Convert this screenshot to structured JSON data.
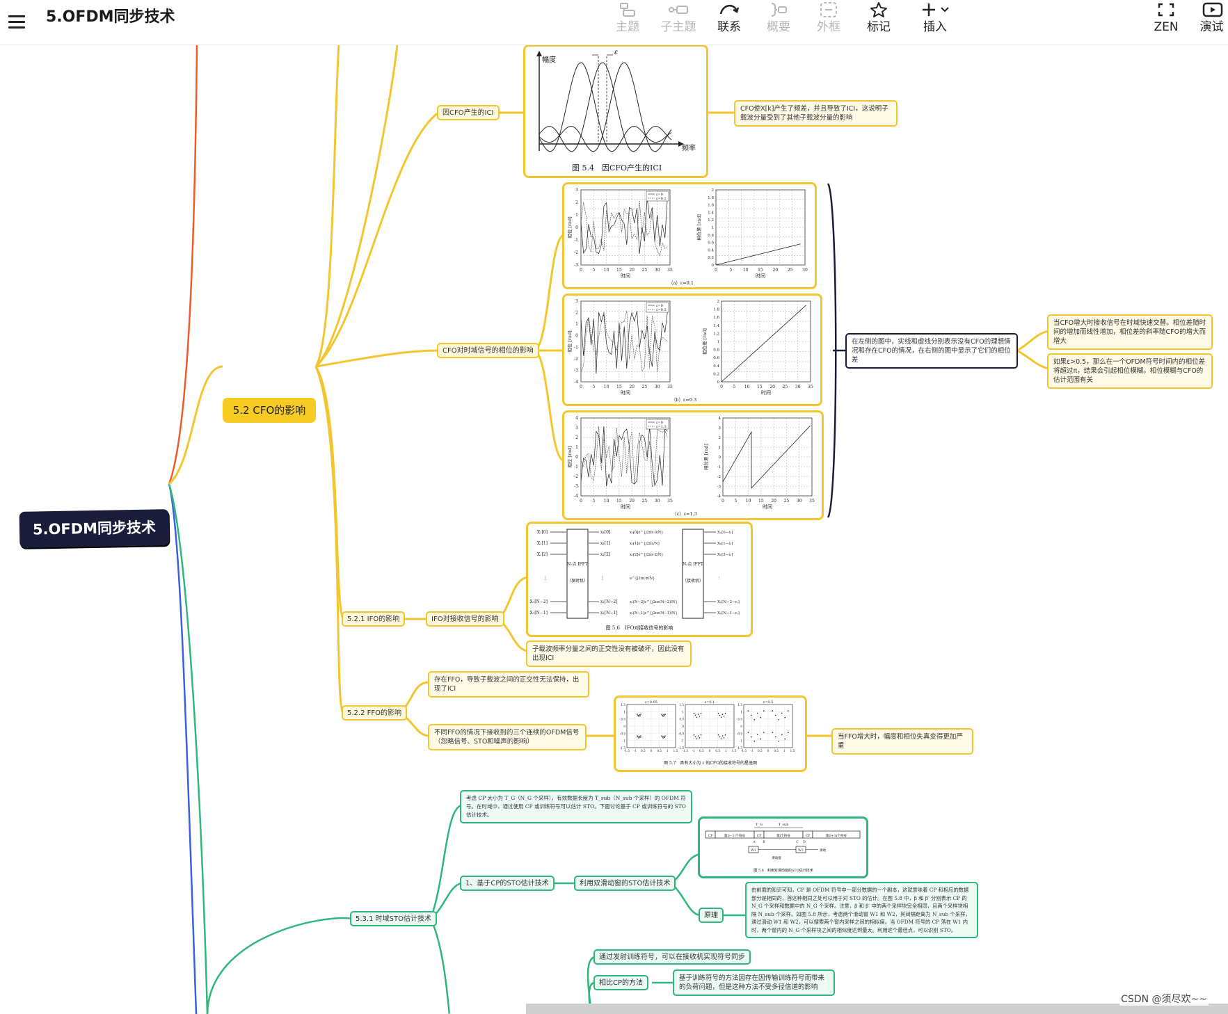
{
  "title": "5.OFDM同步技术",
  "toolbar": {
    "topic": "主题",
    "subtopic": "子主题",
    "relation": "联系",
    "summary": "概要",
    "boundary": "外框",
    "marker": "标记",
    "insert": "插入",
    "zen": "ZEN",
    "present": "演试"
  },
  "mindmap": {
    "root": "5.OFDM同步技术",
    "cfo": {
      "label": "5.2 CFO的影响",
      "ici": {
        "label": "因CFO产生的ICI",
        "note": "CFO使X[k]产生了频差，并且导致了ICI，这说明子载波分量受到了其他子载波分量的影响",
        "fig": {
          "ylabel": "幅度",
          "xlabel": "频率",
          "eps": "ε",
          "caption": "图 5.4　因CFO产生的ICI"
        }
      },
      "phase": {
        "label": "CFO对时域信号的相位的影响",
        "desc": "在左侧的图中，实线和虚线分别表示没有CFO的理想情况和存在CFO的情况，在右侧的图中显示了它们的相位差",
        "notes": [
          "当CFO增大时接收信号在时域快速交替。相位差随时间的增加而线性增加，相位差的斜率随CFO的增大而增大",
          "如果ε>0.5，那么在一个OFDM符号时间内的相位差将超过π，结果会引起相位模糊。相位模糊与CFO的估计范围有关"
        ],
        "panels": [
          {
            "left_ylabel": "相位 [rad]",
            "right_ylabel": "相位差 [rad]",
            "xlabel": "时间",
            "left_yticks": [
              "3",
              "2",
              "1",
              "0",
              "-1",
              "-2",
              "-3"
            ],
            "right_yticks": [
              "2",
              "1.8",
              "1.6",
              "1.4",
              "1.2",
              "1",
              "0.8",
              "0.6",
              "0.4",
              "0.2",
              "0"
            ],
            "xticks": [
              "0",
              "5",
              "10",
              "15",
              "20",
              "25",
              "30",
              "35"
            ],
            "right_xticks": [
              "0",
              "5",
              "10",
              "15",
              "20",
              "25",
              "30"
            ],
            "legend": [
              "ε=0",
              "ε=0.1"
            ],
            "caption": "（a）ε=0.1"
          },
          {
            "left_ylabel": "相位 [rad]",
            "right_ylabel": "相位差 [rad]",
            "xlabel": "时间",
            "left_yticks": [
              "3",
              "2",
              "1",
              "0",
              "-1",
              "-2",
              "-3",
              "-4"
            ],
            "right_yticks": [
              "2",
              "1.8",
              "1.6",
              "1.4",
              "1.2",
              "1",
              "0.8",
              "0.6",
              "0.4",
              "0.2",
              "0"
            ],
            "xticks": [
              "0",
              "5",
              "10",
              "15",
              "20",
              "25",
              "30",
              "35"
            ],
            "right_xticks": [
              "0",
              "5",
              "10",
              "15",
              "20",
              "25",
              "30",
              "35"
            ],
            "legend": [
              "ε=0",
              "ε=0.5"
            ],
            "caption": "（b）ε=0.3"
          },
          {
            "left_ylabel": "相位 [rad]",
            "right_ylabel": "相位差 [rad]",
            "xlabel": "时间",
            "left_yticks": [
              "4",
              "3",
              "2",
              "1",
              "0",
              "-1",
              "-2",
              "-3",
              "-4"
            ],
            "right_yticks": [
              "4",
              "3",
              "2",
              "1",
              "0",
              "-1",
              "-2",
              "-3",
              "-4"
            ],
            "xticks": [
              "0",
              "5",
              "10",
              "15",
              "20",
              "25",
              "30",
              "35"
            ],
            "right_xticks": [
              "0",
              "5",
              "10",
              "15",
              "20",
              "25",
              "30",
              "35"
            ],
            "legend": [
              "ε=0",
              "ε=1.3"
            ],
            "caption": "（c）ε=1.3"
          }
        ]
      },
      "ifo": {
        "label": "5.2.1 IFO的影响",
        "child": "IFO对接收信号的影响",
        "note": "子载波频率分量之间的正交性没有被破坏，因此没有出现ICI",
        "fig": {
          "tx_block": "N-点 IFFT",
          "tx_label": "（发射机）",
          "rx_block": "N-点 IFFT",
          "rx_label": "（接收机）",
          "inputs": [
            "X₁[0]",
            "X₁[1]",
            "X₁[2]",
            "⋮",
            "X₁[N−2]",
            "X₁[N−1]"
          ],
          "tx_out": [
            "x₁[0]",
            "x₁[1]",
            "x₁[2]",
            "⋮",
            "x₁[N−2]",
            "x₁[N−1]"
          ],
          "channel": [
            "x₁[0]e^{j2πε·0/N}",
            "x₁[1]e^{j2πε/N}",
            "x₁[2]e^{j2πε·2/N}",
            "e^{j2πε·n/N}",
            "x₁[N−2]e^{j2πε(N−2)/N}",
            "x₁[N−1]e^{j2πε(N−1)/N}"
          ],
          "outputs": [
            "X₁[0−εᵢ]",
            "X₁[1−εᵢ]",
            "X₁[2−εᵢ]",
            "⋮",
            "X₁[N−2−εᵢ]",
            "X₁[N−1−εᵢ]"
          ],
          "caption": "图 5.6　IFO对接收信号的影响"
        }
      },
      "ffo": {
        "label": "5.2.2 FFO的影响",
        "child1": "存在FFO，导致子载波之间的正交性无法保持，出现了ICI",
        "child2": "不同FFO的情况下接收到的三个连续的OFDM信号（忽略信号、STO和噪声的影响）",
        "note": "当FFO增大时，幅度和相位失真变得更加严重",
        "fig": {
          "titles": [
            "ε=0.05",
            "ε=0.1",
            "ε=0.5"
          ],
          "yticks": [
            "1.5",
            "1",
            "0.5",
            "0",
            "-0.5",
            "-1",
            "-1.5"
          ],
          "xticks": [
            "-1.5",
            "-1",
            "0.5",
            "0",
            "0.5",
            "1",
            "1.5"
          ],
          "caption": "图 5.7　具有大小为 ε 的CFO的接收符号的星座图"
        }
      }
    },
    "sto": {
      "label": "5.3.1 时域STO估计技术",
      "intro": "考虑 CP 大小为 T_G（N_G 个采样），有效数据长度为 T_sub（N_sub 个采样）的 OFDM 符号。在时域中，通过使用 CP 或训练符号可以估计 STO。下面讨论基于 CP 或训练符号的 STO 估计技术。",
      "cp_based": "1、基于CP的STO估计技术",
      "sliding": "利用双滑动窗的STO估计技术",
      "principle": "原理",
      "principle_text": "由前面的知识可知，CP 是 OFDM 符号中一部分数据的一个副本，这就意味着 CP 和相应的数据部分是相同的，首这种相同之处可以用于对 STO 的估计。在图 5.8 中，β 和 β′ 分别表示 CP 的 N_G 个采样和数据中的 N_G 个采样。注意，β 和 β′ 中的两个采样块完全相同，且两个采样块相隔 N_sub 个采样。如图 5.8 所示，考虑两个滑动窗 W1 和 W2，其间隔距离为 N_sub 个采样，通过滑动 W1 和 W2，可以搜索两个窗内采样之间的相似度。当 OFDM 符号的 CP 落在 W1 内时，两个窗内的 N_G 个采样块之间的相似度达到最大。利用这个最佳点，可以识别 STO。",
      "fig": {
        "segments": [
          "CP",
          "第(l−1)个符号",
          "CP",
          "第l个符号",
          "CP",
          "第(l+1)个符号"
        ],
        "marks": [
          "A",
          "B",
          "C",
          "D"
        ],
        "w1": "W1",
        "w2": "W2",
        "tg": "T_G",
        "tsub": "T_sub",
        "slide": "滑动窗",
        "move": "滑动",
        "caption": "图 5.8　利用双滑动窗的STO估计技术"
      },
      "training": "通过发射训练符号，可以在接收机实现符号同步",
      "compare": "相比CP的方法",
      "compare_note": "基于训练符号的方法因存在因传输训练符号而带来的负荷问题，但是这种方法不受多径信道的影响"
    }
  },
  "colors": {
    "cfo_branch": "#f3c62f",
    "sto_branch": "#2fb67c",
    "blue_branch": "#3a5fe0",
    "red_branch": "#ef5a2c",
    "root_bg": "#1a1c3a"
  },
  "watermark": "CSDN @须尽欢~~"
}
